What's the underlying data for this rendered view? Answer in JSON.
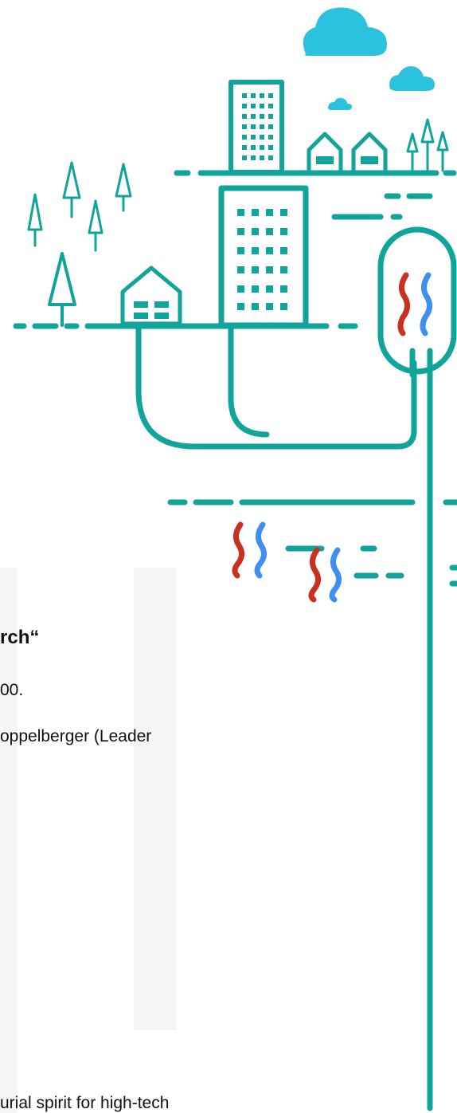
{
  "text": {
    "heading_fragment": "rch“",
    "line1_fragment": "00.",
    "line2_fragment": "oppelberger  (Leader",
    "line3_fragment": "urial spirit for high-tech"
  },
  "colors": {
    "teal": "#10a49b",
    "cloud": "#2ac2df",
    "heat_red": "#c8311f",
    "heat_blue": "#3f8ff0",
    "background_column": "#f5f5f5"
  },
  "icons": [
    "cloud-icon",
    "tower-icon",
    "house-icon",
    "tree-icon",
    "heat-wave-icon",
    "geothermal-probe-icon"
  ]
}
